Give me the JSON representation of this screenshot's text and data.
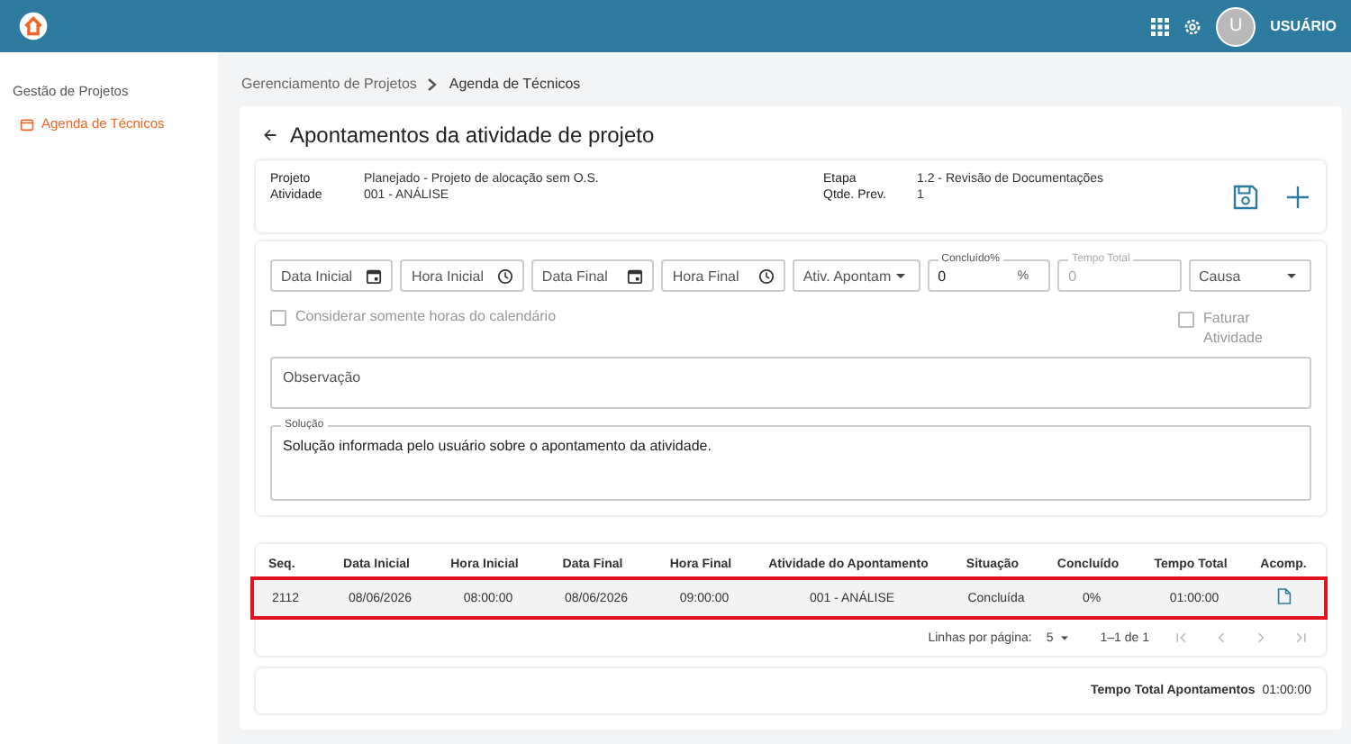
{
  "topbar": {
    "avatar_letter": "U",
    "user_name": "USUÁRIO"
  },
  "sidebar": {
    "section": "Gestão de Projetos",
    "items": [
      {
        "label": "Agenda de Técnicos",
        "selected": true
      }
    ]
  },
  "breadcrumb": [
    "Gerenciamento de Projetos",
    "Agenda de Técnicos"
  ],
  "page": {
    "title": "Apontamentos da atividade de projeto"
  },
  "info": {
    "left": [
      {
        "label": "Projeto",
        "value": "Planejado - Projeto de alocação sem O.S."
      },
      {
        "label": "Atividade",
        "value": "001 - ANÁLISE"
      }
    ],
    "right": [
      {
        "label": "Etapa",
        "value": "1.2 - Revisão de Documentações"
      },
      {
        "label": "Qtde. Prev.",
        "value": "1"
      }
    ]
  },
  "fields": [
    {
      "kind": "date",
      "placeholder": "Data Inicial"
    },
    {
      "kind": "time",
      "placeholder": "Hora Inicial"
    },
    {
      "kind": "date",
      "placeholder": "Data Final"
    },
    {
      "kind": "time",
      "placeholder": "Hora Final"
    },
    {
      "kind": "select",
      "placeholder": "Ativ. Apontam"
    },
    {
      "kind": "percent",
      "label": "Concluído%",
      "value": "0",
      "suffix": "%",
      "disabled": false
    },
    {
      "kind": "number",
      "label": "Tempo Total",
      "value": "0",
      "disabled": true
    },
    {
      "kind": "select",
      "placeholder": "Causa"
    }
  ],
  "options": [
    {
      "label": "Considerar somente horas do calendário",
      "checked": false,
      "disabled": true
    },
    {
      "label": "Faturar Atividade",
      "checked": false,
      "disabled": true
    }
  ],
  "observacao": {
    "placeholder": "Observação"
  },
  "solucao": {
    "label": "Solução",
    "value": "Solução informada pelo usuário sobre o apontamento da atividade."
  },
  "table": {
    "columns": [
      "Seq.",
      "Data Inicial",
      "Hora Inicial",
      "Data Final",
      "Hora Final",
      "Atividade do Apontamento",
      "Situação",
      "Concluído",
      "Tempo Total",
      "Acomp."
    ],
    "rows": [
      {
        "cells": [
          "2112",
          "08/06/2026",
          "08:00:00",
          "08/06/2026",
          "09:00:00",
          "001 - ANÁLISE",
          "Concluída",
          "0%",
          "01:00:00"
        ],
        "highlighted": true
      }
    ],
    "pagination": {
      "rows_per_page_label": "Linhas por página:",
      "rows_per_page": "5",
      "range": "1–1 de 1"
    }
  },
  "total": {
    "label": "Tempo Total Apontamentos",
    "value": "01:00:00"
  }
}
